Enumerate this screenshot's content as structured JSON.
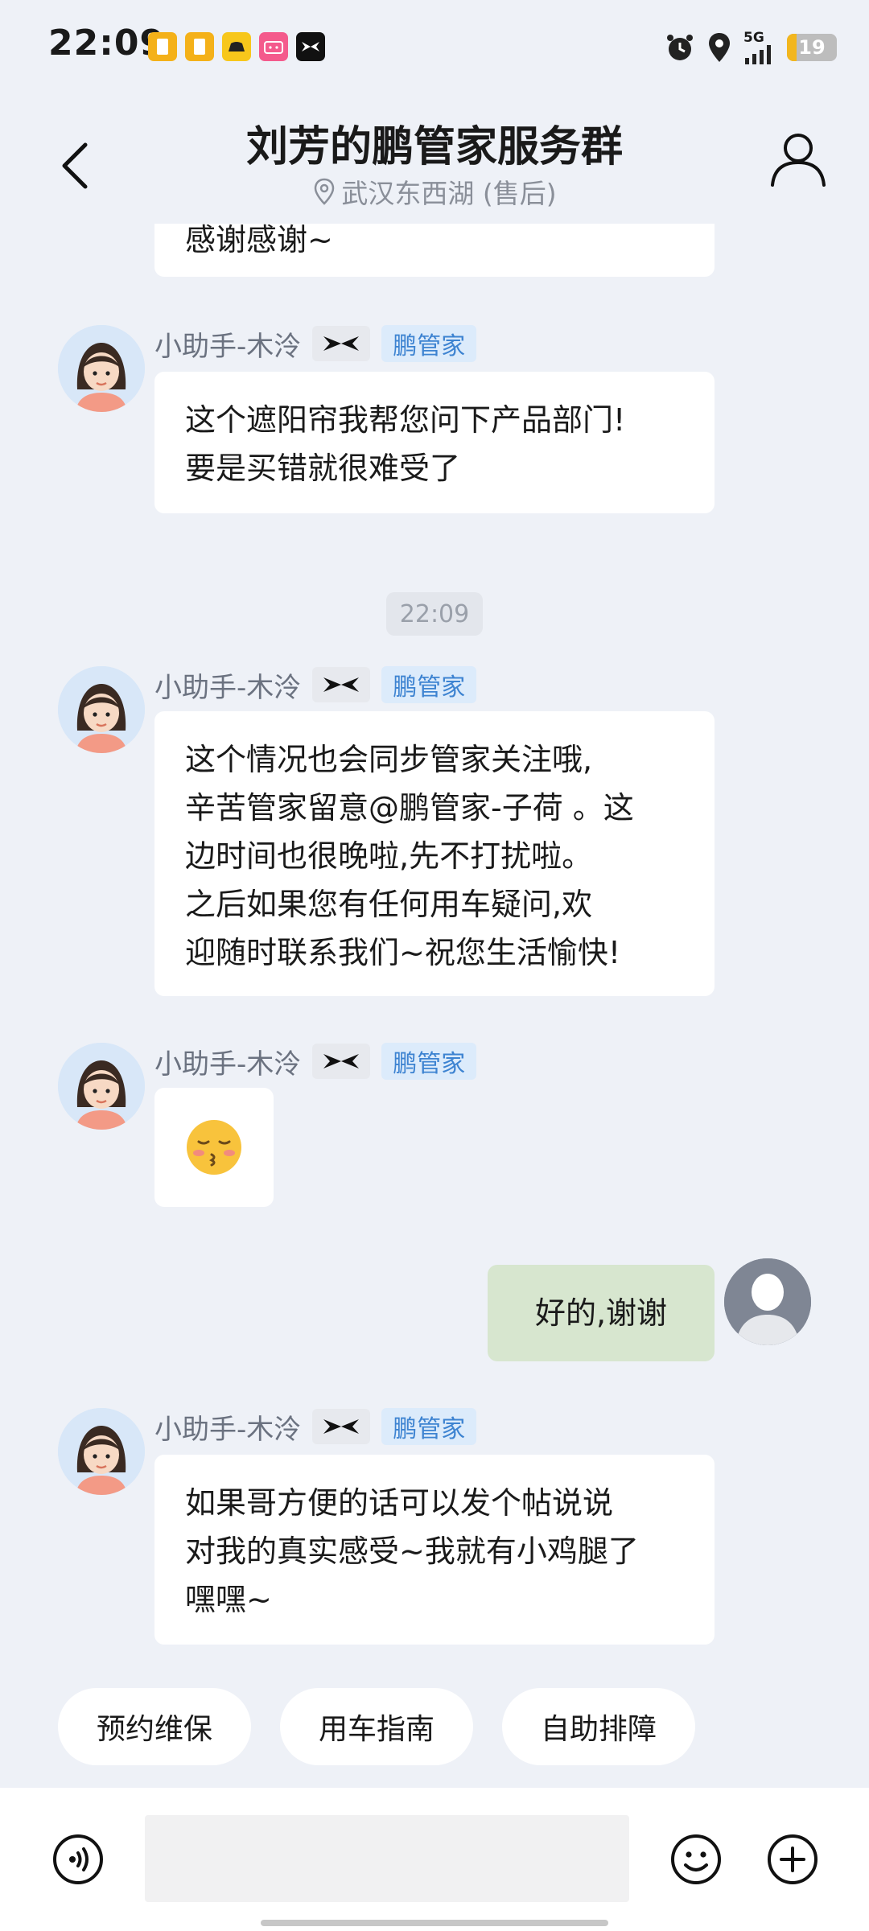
{
  "status_bar": {
    "time": "22:09",
    "notification_icons": [
      "sim-card-icon",
      "sim-card-icon",
      "taxi-app-icon",
      "bilibili-icon",
      "xpeng-app-icon"
    ],
    "network": "5G",
    "battery": "19",
    "battery_color": "#F2B61E"
  },
  "header": {
    "title": "刘芳的鹏管家服务群",
    "location": "武汉东西湖 (售后)"
  },
  "messages": [
    {
      "text": "感谢感谢~"
    },
    {
      "sender": "小助手-木泠",
      "role": "鹏管家",
      "lines": [
        "这个遮阳帘我帮您问下产品部门!",
        "要是买错就很难受了"
      ]
    },
    {
      "sender": "小助手-木泠",
      "role": "鹏管家",
      "lines": [
        "这个情况也会同步管家关注哦,",
        "辛苦管家留意@鹏管家-子荷 。这",
        "边时间也很晚啦,先不打扰啦。",
        "之后如果您有任何用车疑问,欢",
        "迎随时联系我们~祝您生活愉快!"
      ]
    },
    {
      "sender": "小助手-木泠",
      "role": "鹏管家",
      "emoji": "😚"
    },
    {
      "text": "好的,谢谢"
    },
    {
      "sender": "小助手-木泠",
      "role": "鹏管家",
      "lines": [
        "如果哥方便的话可以发个帖说说",
        "对我的真实感受~我就有小鸡腿了",
        "嘿嘿~"
      ]
    }
  ],
  "timestamp": "22:09",
  "quick_actions": [
    "预约维保",
    "用车指南",
    "自助排障"
  ],
  "colors": {
    "background": "#EEF1F7",
    "own_bubble": "#D7E6CF",
    "role_badge_bg": "#DCEBFB",
    "role_badge_text": "#3D83D1"
  }
}
